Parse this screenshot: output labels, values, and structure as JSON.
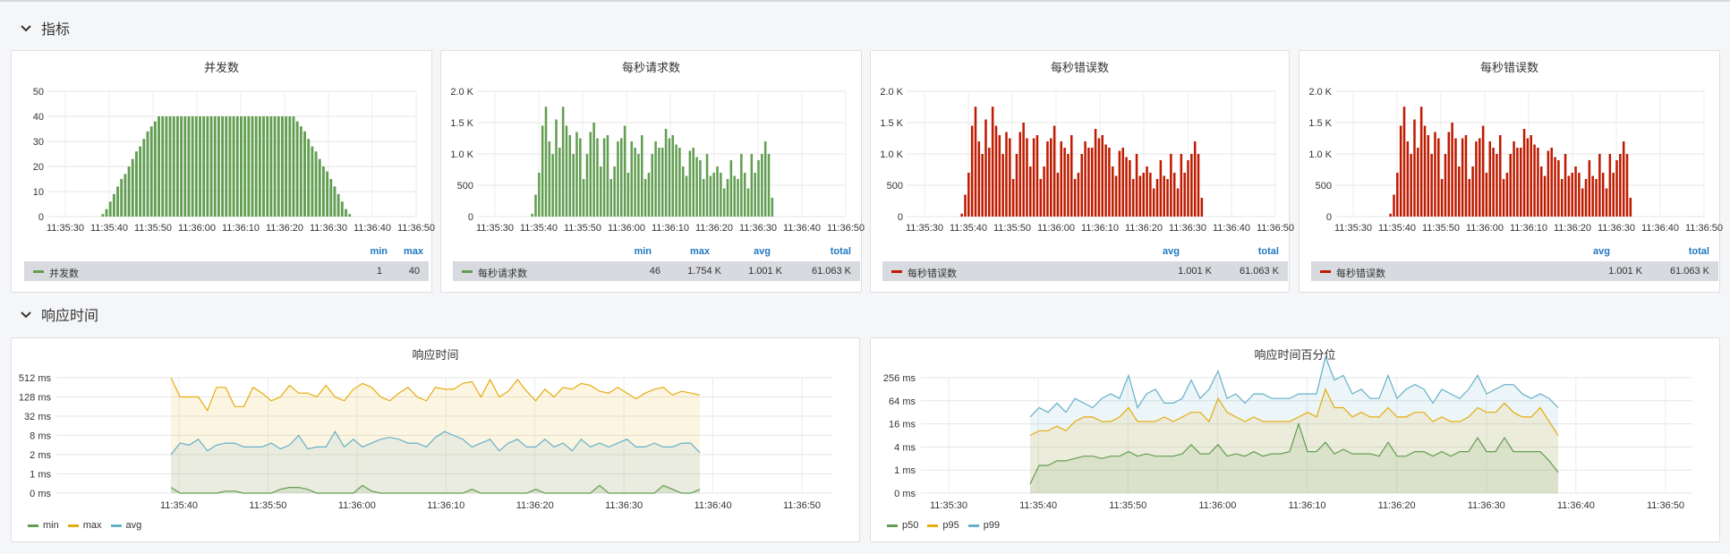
{
  "rows": [
    {
      "title": "指标"
    },
    {
      "title": "响应时间"
    }
  ],
  "colors": {
    "green": "#629e51",
    "red": "#bf1b00",
    "orange": "#e5ac0e",
    "blue": "#64b0c8",
    "blue_legend": "#1f78c1"
  },
  "legends": {
    "p1": {
      "cols": [
        "min",
        "max"
      ],
      "name": "并发数",
      "values": [
        "1",
        "40"
      ]
    },
    "p2": {
      "cols": [
        "min",
        "max",
        "avg",
        "total"
      ],
      "name": "每秒请求数",
      "values": [
        "46",
        "1.754 K",
        "1.001 K",
        "61.063 K"
      ]
    },
    "p3": {
      "cols": [
        "avg",
        "total"
      ],
      "name": "每秒错误数",
      "values": [
        "1.001 K",
        "61.063 K"
      ]
    },
    "p4": {
      "cols": [
        "avg",
        "total"
      ],
      "name": "每秒错误数",
      "values": [
        "1.001 K",
        "61.063 K"
      ]
    },
    "p5": {
      "items": [
        "min",
        "max",
        "avg"
      ]
    },
    "p6": {
      "items": [
        "p50",
        "p95",
        "p99"
      ]
    }
  },
  "chart_data": [
    {
      "type": "bar",
      "title": "并发数",
      "series": [
        {
          "name": "并发数",
          "color": "#629e51"
        }
      ],
      "x_ticks": [
        "11:35:30",
        "11:35:40",
        "11:35:50",
        "11:36:00",
        "11:36:10",
        "11:36:20",
        "11:36:30",
        "11:36:40",
        "11:36:50"
      ],
      "y_ticks": [
        "0",
        "10",
        "20",
        "30",
        "40",
        "50"
      ],
      "ylim": [
        0,
        50
      ],
      "values": [
        1,
        3,
        6,
        9,
        12,
        15,
        17,
        20,
        23,
        26,
        28,
        31,
        34,
        36,
        38,
        40,
        40,
        40,
        40,
        40,
        40,
        40,
        40,
        40,
        40,
        40,
        40,
        40,
        40,
        40,
        40,
        40,
        40,
        40,
        40,
        40,
        40,
        40,
        40,
        40,
        40,
        40,
        40,
        40,
        40,
        40,
        40,
        40,
        40,
        40,
        40,
        40,
        38,
        36,
        34,
        31,
        28,
        26,
        23,
        20,
        18,
        15,
        12,
        9,
        6,
        3,
        1
      ]
    },
    {
      "type": "bar",
      "title": "每秒请求数",
      "series": [
        {
          "name": "每秒请求数",
          "color": "#629e51"
        }
      ],
      "x_ticks": [
        "11:35:30",
        "11:35:40",
        "11:35:50",
        "11:36:00",
        "11:36:10",
        "11:36:20",
        "11:36:30",
        "11:36:40",
        "11:36:50"
      ],
      "y_ticks": [
        "0",
        "500",
        "1.0 K",
        "1.5 K",
        "2.0 K"
      ],
      "ylim": [
        0,
        2000
      ],
      "values": [
        46,
        350,
        700,
        1450,
        1754,
        1200,
        1000,
        1550,
        1100,
        1754,
        1450,
        1300,
        1000,
        1350,
        1250,
        600,
        1000,
        1350,
        1500,
        1250,
        800,
        1250,
        1300,
        600,
        800,
        1200,
        1250,
        1450,
        700,
        1200,
        1100,
        1000,
        1300,
        600,
        700,
        1000,
        1200,
        1100,
        1100,
        1400,
        1250,
        1300,
        1150,
        1100,
        800,
        650,
        1050,
        1100,
        950,
        900,
        600,
        1000,
        650,
        700,
        800,
        700,
        450,
        600,
        900,
        650,
        600,
        1000,
        700,
        450,
        1000,
        700,
        900,
        1000,
        1200,
        1000,
        300
      ]
    },
    {
      "type": "bar",
      "title": "每秒错误数",
      "series": [
        {
          "name": "每秒错误数",
          "color": "#bf1b00"
        }
      ],
      "x_ticks": [
        "11:35:30",
        "11:35:40",
        "11:35:50",
        "11:36:00",
        "11:36:10",
        "11:36:20",
        "11:36:30",
        "11:36:40",
        "11:36:50"
      ],
      "y_ticks": [
        "0",
        "500",
        "1.0 K",
        "1.5 K",
        "2.0 K"
      ],
      "ylim": [
        0,
        2000
      ],
      "values": [
        46,
        350,
        700,
        1450,
        1754,
        1200,
        1000,
        1550,
        1100,
        1754,
        1450,
        1300,
        1000,
        1350,
        1250,
        600,
        1000,
        1350,
        1500,
        1250,
        800,
        1250,
        1300,
        600,
        800,
        1200,
        1250,
        1450,
        700,
        1200,
        1100,
        1000,
        1300,
        600,
        700,
        1000,
        1200,
        1100,
        1100,
        1400,
        1250,
        1300,
        1150,
        1100,
        800,
        650,
        1050,
        1100,
        950,
        900,
        600,
        1000,
        650,
        700,
        800,
        700,
        450,
        600,
        900,
        650,
        600,
        1000,
        700,
        450,
        1000,
        700,
        900,
        1000,
        1200,
        1000,
        300
      ]
    },
    {
      "type": "bar",
      "title": "每秒错误数",
      "series": [
        {
          "name": "每秒错误数",
          "color": "#bf1b00"
        }
      ],
      "x_ticks": [
        "11:35:30",
        "11:35:40",
        "11:35:50",
        "11:36:00",
        "11:36:10",
        "11:36:20",
        "11:36:30",
        "11:36:40",
        "11:36:50"
      ],
      "y_ticks": [
        "0",
        "500",
        "1.0 K",
        "1.5 K",
        "2.0 K"
      ],
      "ylim": [
        0,
        2000
      ],
      "values": [
        46,
        350,
        700,
        1450,
        1754,
        1200,
        1000,
        1550,
        1100,
        1754,
        1450,
        1300,
        1000,
        1350,
        1250,
        600,
        1000,
        1350,
        1500,
        1250,
        800,
        1250,
        1300,
        600,
        800,
        1200,
        1250,
        1450,
        700,
        1200,
        1100,
        1000,
        1300,
        600,
        700,
        1000,
        1200,
        1100,
        1100,
        1400,
        1250,
        1300,
        1150,
        1100,
        800,
        650,
        1050,
        1100,
        950,
        900,
        600,
        1000,
        650,
        700,
        800,
        700,
        450,
        600,
        900,
        650,
        600,
        1000,
        700,
        450,
        1000,
        700,
        900,
        1000,
        1200,
        1000,
        300
      ]
    },
    {
      "type": "area",
      "title": "响应时间",
      "scale": "log2",
      "x_ticks": [
        "11:35:40",
        "11:35:50",
        "11:36:00",
        "11:36:10",
        "11:36:20",
        "11:36:30",
        "11:36:40",
        "11:36:50"
      ],
      "y_ticks": [
        "0 ms",
        "1 ms",
        "2 ms",
        "8 ms",
        "32 ms",
        "128 ms",
        "512 ms"
      ],
      "series": [
        {
          "name": "max",
          "color": "#e5ac0e",
          "values": [
            6,
            5,
            5,
            5,
            4.3,
            5.5,
            5.5,
            4.5,
            4.5,
            5.5,
            5.2,
            4.8,
            5,
            5.6,
            5.2,
            5.2,
            5,
            5.6,
            5,
            4.8,
            5.4,
            5.7,
            5.5,
            5,
            4.8,
            5.2,
            5.5,
            5,
            4.8,
            5.5,
            5.4,
            5.4,
            5.7,
            5.8,
            5,
            5.9,
            5,
            5.3,
            5.9,
            5.3,
            4.8,
            5.4,
            5,
            5.5,
            5.4,
            5.7,
            5.6,
            5.3,
            5.2,
            5.5,
            5.2,
            4.9,
            5.2,
            5.4,
            5.5,
            5.1,
            5.3,
            5.2,
            5.1
          ]
        },
        {
          "name": "avg",
          "color": "#64b0c8",
          "values": [
            2,
            2.6,
            2.5,
            2.8,
            2.2,
            2.5,
            2.6,
            2.6,
            2.4,
            2.4,
            2.4,
            2.6,
            2.3,
            2.5,
            3,
            2.3,
            2.4,
            2.4,
            3.2,
            2.4,
            2.8,
            2.4,
            2.6,
            2.8,
            2.9,
            2.8,
            2.6,
            2.6,
            2.4,
            2.9,
            3.2,
            3,
            2.8,
            2.4,
            2.6,
            2.8,
            2.2,
            2.6,
            2.8,
            2.4,
            2.4,
            2.8,
            2.4,
            2.6,
            2.2,
            2.8,
            2.4,
            2.6,
            2.4,
            2.6,
            2.8,
            2.4,
            2.4,
            2.6,
            2.4,
            2.4,
            2.6,
            2.6,
            2.1
          ]
        },
        {
          "name": "min",
          "color": "#629e51",
          "values": [
            0.3,
            0,
            0,
            0,
            0,
            0,
            0.1,
            0.1,
            0,
            0,
            0,
            0,
            0.2,
            0.3,
            0.3,
            0.2,
            0,
            0,
            0,
            0,
            0,
            0.4,
            0.1,
            0,
            0,
            0,
            0,
            0,
            0,
            0,
            0,
            0,
            0,
            0.2,
            0,
            0,
            0,
            0,
            0,
            0,
            0.2,
            0,
            0,
            0,
            0,
            0,
            0,
            0.4,
            0,
            0,
            0,
            0,
            0,
            0,
            0.4,
            0.2,
            0,
            0,
            0.2
          ]
        }
      ]
    },
    {
      "type": "area",
      "title": "响应时间百分位",
      "scale": "log2",
      "x_ticks": [
        "11:35:30",
        "11:35:40",
        "11:35:50",
        "11:36:00",
        "11:36:10",
        "11:36:20",
        "11:36:30",
        "11:36:40",
        "11:36:50"
      ],
      "y_ticks": [
        "0 ms",
        "1 ms",
        "4 ms",
        "16 ms",
        "64 ms",
        "256 ms"
      ],
      "series": [
        {
          "name": "p99",
          "color": "#64b0c8",
          "values": [
            3.3,
            3.7,
            3.5,
            3.9,
            3.5,
            4.1,
            3.9,
            3.7,
            4.1,
            4.3,
            4.1,
            5.1,
            3.7,
            4.3,
            4.5,
            3.9,
            3.9,
            4.1,
            4.9,
            4.1,
            4.5,
            5.3,
            4.1,
            4.3,
            3.9,
            4.3,
            4.3,
            4.1,
            4.1,
            4.1,
            4.3,
            4.3,
            4.3,
            5.9,
            4.9,
            5.1,
            4.3,
            4.5,
            4.1,
            4.1,
            5.1,
            4.1,
            4.5,
            4.7,
            4.5,
            3.9,
            4.5,
            4.3,
            4.1,
            4.5,
            5.1,
            4.3,
            4.5,
            4.7,
            4.7,
            4.3,
            4.1,
            4.3,
            4.1,
            3.7
          ]
        },
        {
          "name": "p95",
          "color": "#e5ac0e",
          "values": [
            2.5,
            2.7,
            2.7,
            2.9,
            2.7,
            3.1,
            3.3,
            3.3,
            3.1,
            3.1,
            3.3,
            3.7,
            3.1,
            3.1,
            3.1,
            3.3,
            3.1,
            3.3,
            3.5,
            3.5,
            3.1,
            4.1,
            3.5,
            3.3,
            3.1,
            3.3,
            3.1,
            3.1,
            3.1,
            3.1,
            3.3,
            3.5,
            3.3,
            4.5,
            3.7,
            3.7,
            3.3,
            3.5,
            3.3,
            3.3,
            3.7,
            3.3,
            3.3,
            3.5,
            3.5,
            3.1,
            3.3,
            3.1,
            3.1,
            3.3,
            3.7,
            3.5,
            3.5,
            3.9,
            3.5,
            3.3,
            3.3,
            3.7,
            3.1,
            2.5
          ]
        },
        {
          "name": "p50",
          "color": "#629e51",
          "values": [
            0.4,
            1.2,
            1.2,
            1.4,
            1.4,
            1.5,
            1.6,
            1.6,
            1.5,
            1.6,
            1.6,
            1.8,
            1.6,
            1.7,
            1.6,
            1.6,
            1.6,
            1.7,
            2.1,
            1.7,
            1.7,
            2.1,
            1.6,
            1.7,
            1.6,
            1.8,
            1.6,
            1.7,
            1.7,
            1.8,
            3,
            1.8,
            1.8,
            2.2,
            1.7,
            1.9,
            1.7,
            1.7,
            1.7,
            1.6,
            2.2,
            1.6,
            1.6,
            1.8,
            1.8,
            1.6,
            1.8,
            1.6,
            1.8,
            1.8,
            2.4,
            1.8,
            1.8,
            2.4,
            1.8,
            1.8,
            1.8,
            1.8,
            1.4,
            0.9
          ]
        }
      ]
    }
  ]
}
